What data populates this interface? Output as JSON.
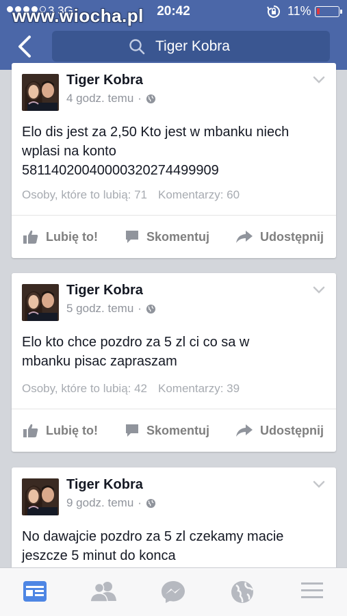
{
  "status_bar": {
    "watermark": "www.wiocha.pl",
    "carrier": "3  3G",
    "time": "20:42",
    "battery": "11%",
    "battery_level": 0.11
  },
  "nav": {
    "search_text": "Tiger Kobra"
  },
  "posts": [
    {
      "author": "Tiger Kobra",
      "time": "4 godz. temu",
      "text_lines": [
        "Elo dis jest za 2,50 Kto jest w mbanku  niech",
        "wplasi na konto",
        "58114020040000320274499909"
      ],
      "likes": "Osoby, które to lubią: 71",
      "comments": "Komentarzy: 60"
    },
    {
      "author": "Tiger Kobra",
      "time": "5 godz. temu",
      "text_lines": [
        "Elo kto chce pozdro za 5 zl ci co sa w",
        "mbanku pisac zapraszam"
      ],
      "likes": "Osoby, które to lubią: 42",
      "comments": "Komentarzy: 39"
    },
    {
      "author": "Tiger Kobra",
      "time": "9 godz. temu",
      "text_lines": [
        "No dawajcie pozdro za 5 zl czekamy macie",
        "jeszcze 5 minut do konca"
      ]
    }
  ],
  "actions": {
    "like": "Lubię to!",
    "comment": "Skomentuj",
    "share": "Udostępnij"
  },
  "tabs": [
    "news-feed-icon",
    "friends-icon",
    "messenger-icon",
    "globe-icon",
    "menu-icon"
  ],
  "colors": {
    "nav_bar": "#4b67a8",
    "active_tab": "#4e86e4",
    "inactive_tab": "#b6b9c0"
  }
}
